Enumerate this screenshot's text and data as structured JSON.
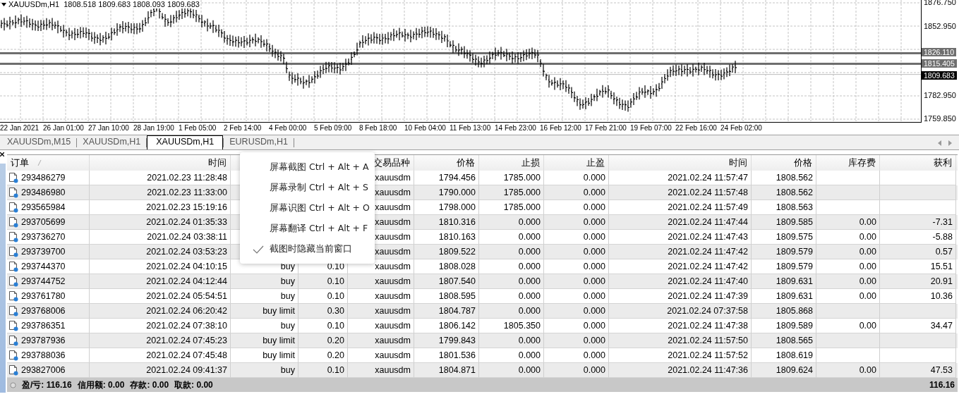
{
  "chart": {
    "legend": "XAUUSDm,H1  1808.518 1809.683 1808.093 1809.683",
    "price_axis": [
      "1876.750",
      "1852.950",
      "1782.950",
      "1759.850"
    ],
    "price_lines": [
      {
        "value": "1826.110",
        "kind": "level"
      },
      {
        "value": "1815.405",
        "kind": "level"
      },
      {
        "value": "1809.683",
        "kind": "bid"
      }
    ],
    "time_axis": [
      "22 Jan 2021",
      "26 Jan 01:00",
      "27 Jan 10:00",
      "28 Jan 19:00",
      "1 Feb 05:00",
      "2 Feb 14:00",
      "4 Feb 00:00",
      "5 Feb 09:00",
      "8 Feb 18:00",
      "10 Feb 04:00",
      "11 Feb 13:00",
      "14 Feb 23:00",
      "16 Feb 12:00",
      "17 Feb 21:00",
      "19 Feb 07:00",
      "22 Feb 16:00",
      "24 Feb 02:00"
    ]
  },
  "tabs": [
    {
      "label": "XAUUSDm,M15",
      "selected": false
    },
    {
      "label": "XAUUSDm,H1",
      "selected": false
    },
    {
      "label": "XAUUSDm,H1",
      "selected": true
    },
    {
      "label": "EURUSDm,H1",
      "selected": false
    }
  ],
  "table": {
    "header": {
      "order": {
        "label": "订单",
        "sorted": true
      },
      "open_time": {
        "label": "时间",
        "sorted": false
      },
      "symbol": {
        "label": "交易品种",
        "sorted": false
      },
      "open_price": {
        "label": "价格",
        "sorted": false
      },
      "sl": {
        "label": "止损",
        "sorted": false
      },
      "tp": {
        "label": "止盈",
        "sorted": false
      },
      "time": {
        "label": "时间",
        "sorted": false
      },
      "price": {
        "label": "价格",
        "sorted": false
      },
      "swap": {
        "label": "库存费",
        "sorted": false
      },
      "profit": {
        "label": "获利",
        "sorted": false
      }
    },
    "rows": [
      {
        "order": "293486279",
        "open_time": "2021.02.23 11:28:48",
        "symbol": "xauusdm",
        "open_price": "1794.456",
        "sl": "1785.000",
        "tp": "0.000",
        "time": "2021.02.24 11:57:47",
        "price": "1808.562"
      },
      {
        "order": "293486980",
        "open_time": "2021.02.23 11:33:00",
        "symbol": "xauusdm",
        "open_price": "1790.000",
        "sl": "1785.000",
        "tp": "0.000",
        "time": "2021.02.24 11:57:48",
        "price": "1808.562"
      },
      {
        "order": "293565984",
        "open_time": "2021.02.23 15:19:16",
        "symbol": "xauusdm",
        "open_price": "1798.000",
        "sl": "1785.000",
        "tp": "0.000",
        "time": "2021.02.24 11:57:49",
        "price": "1808.563"
      },
      {
        "order": "293705699",
        "open_time": "2021.02.24 01:35:33",
        "symbol": "xauusdm",
        "open_price": "1810.316",
        "sl": "0.000",
        "tp": "0.000",
        "time": "2021.02.24 11:47:44",
        "price": "1809.585",
        "swap": "0.00",
        "profit": "-7.31"
      },
      {
        "order": "293736270",
        "open_time": "2021.02.24 03:38:11",
        "symbol": "xauusdm",
        "open_price": "1810.163",
        "sl": "0.000",
        "tp": "0.000",
        "time": "2021.02.24 11:47:43",
        "price": "1809.575",
        "swap": "0.00",
        "profit": "-5.88"
      },
      {
        "order": "293739700",
        "open_time": "2021.02.24 03:53:23",
        "symbol": "xauusdm",
        "open_price": "1809.522",
        "sl": "0.000",
        "tp": "0.000",
        "time": "2021.02.24 11:47:42",
        "price": "1809.579",
        "swap": "0.00",
        "profit": "0.57"
      },
      {
        "order": "293744370",
        "open_time": "2021.02.24 04:10:15",
        "type": "buy",
        "volume": "0.10",
        "symbol": "xauusdm",
        "open_price": "1808.028",
        "sl": "0.000",
        "tp": "0.000",
        "time": "2021.02.24 11:47:42",
        "price": "1809.579",
        "swap": "0.00",
        "profit": "15.51"
      },
      {
        "order": "293744752",
        "open_time": "2021.02.24 04:12:44",
        "type": "buy",
        "volume": "0.10",
        "symbol": "xauusdm",
        "open_price": "1807.540",
        "sl": "0.000",
        "tp": "0.000",
        "time": "2021.02.24 11:47:40",
        "price": "1809.631",
        "swap": "0.00",
        "profit": "20.91"
      },
      {
        "order": "293761780",
        "open_time": "2021.02.24 05:54:51",
        "type": "buy",
        "volume": "0.10",
        "symbol": "xauusdm",
        "open_price": "1808.595",
        "sl": "0.000",
        "tp": "0.000",
        "time": "2021.02.24 11:47:39",
        "price": "1809.631",
        "swap": "0.00",
        "profit": "10.36"
      },
      {
        "order": "293768006",
        "open_time": "2021.02.24 06:20:42",
        "type": "buy limit",
        "volume": "0.30",
        "symbol": "xauusdm",
        "open_price": "1804.787",
        "sl": "0.000",
        "tp": "0.000",
        "time": "2021.02.24 07:37:58",
        "price": "1805.868"
      },
      {
        "order": "293786351",
        "open_time": "2021.02.24 07:38:10",
        "type": "buy",
        "volume": "0.10",
        "symbol": "xauusdm",
        "open_price": "1806.142",
        "sl": "1805.350",
        "tp": "0.000",
        "time": "2021.02.24 11:47:38",
        "price": "1809.589",
        "swap": "0.00",
        "profit": "34.47"
      },
      {
        "order": "293787936",
        "open_time": "2021.02.24 07:45:23",
        "type": "buy limit",
        "volume": "0.20",
        "symbol": "xauusdm",
        "open_price": "1799.843",
        "sl": "0.000",
        "tp": "0.000",
        "time": "2021.02.24 11:57:50",
        "price": "1808.565"
      },
      {
        "order": "293788036",
        "open_time": "2021.02.24 07:45:48",
        "type": "buy limit",
        "volume": "0.20",
        "symbol": "xauusdm",
        "open_price": "1801.536",
        "sl": "0.000",
        "tp": "0.000",
        "time": "2021.02.24 11:57:52",
        "price": "1808.619"
      },
      {
        "order": "293827006",
        "open_time": "2021.02.24 09:41:37",
        "type": "buy",
        "volume": "0.10",
        "symbol": "xauusdm",
        "open_price": "1804.871",
        "sl": "0.000",
        "tp": "0.000",
        "time": "2021.02.24 11:47:36",
        "price": "1809.624",
        "swap": "0.00",
        "profit": "47.53"
      }
    ],
    "summary": [
      "盈/亏: 116.16",
      "信用额: 0.00",
      "存款: 0.00",
      "取款: 0.00"
    ],
    "total": "116.16"
  },
  "context_menu": [
    {
      "label": "屏幕截图 Ctrl + Alt + A",
      "checked": false
    },
    {
      "label": "屏幕录制 Ctrl + Alt + S",
      "checked": false
    },
    {
      "label": "屏幕识图 Ctrl + Alt + O",
      "checked": false
    },
    {
      "label": "屏幕翻译 Ctrl + Alt + F",
      "checked": false
    },
    {
      "label": "截图时隐藏当前窗口",
      "checked": true
    }
  ]
}
